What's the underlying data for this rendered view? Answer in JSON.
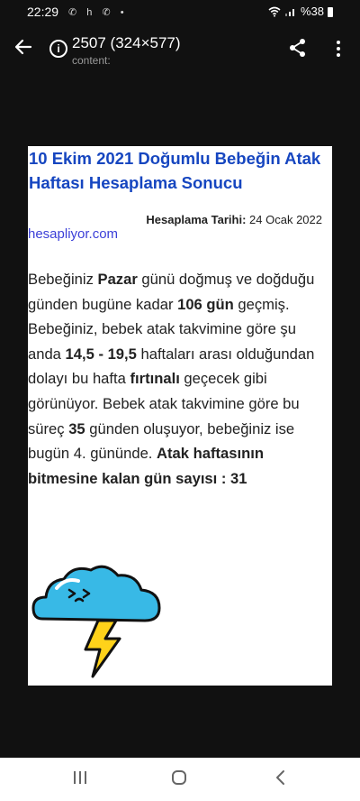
{
  "status": {
    "time": "22:29",
    "notification_icons": "✆ h ✆ •",
    "battery": "%38"
  },
  "appbar": {
    "title": "2507 (324×577)",
    "subtitle": "content:"
  },
  "document": {
    "heading": "10 Ekim 2021 Doğumlu Bebeğin Atak Haftası Hesaplama Sonucu",
    "date_label": "Hesaplama Tarihi:",
    "date_value": "24 Ocak 2022",
    "site": "hesapliyor.com",
    "body": {
      "p1": "Bebeğiniz ",
      "b1": "Pazar",
      "p2": " günü doğmuş ve doğduğu günden bugüne kadar ",
      "b2": "106 gün",
      "p3": " geçmiş. Bebeğiniz, bebek atak takvimine göre şu anda ",
      "b3": "14,5 - 19,5",
      "p4": " haftaları arası olduğundan dolayı bu hafta ",
      "b4": "fırtınalı",
      "p5": " geçecek gibi görünüyor. Bebek atak takvimine göre bu süreç ",
      "b5": "35",
      "p6": " günden oluşuyor, bebeğiniz ise bugün 4. gününde. ",
      "b6": "Atak haftasının bitmesine kalan gün sayısı : 31"
    },
    "illustration_icon": "storm-cloud-lightning-icon"
  },
  "colors": {
    "heading": "#1646c0",
    "site_link": "#3b3fd8",
    "cloud": "#38b9e6",
    "lightning": "#ffd21a"
  }
}
